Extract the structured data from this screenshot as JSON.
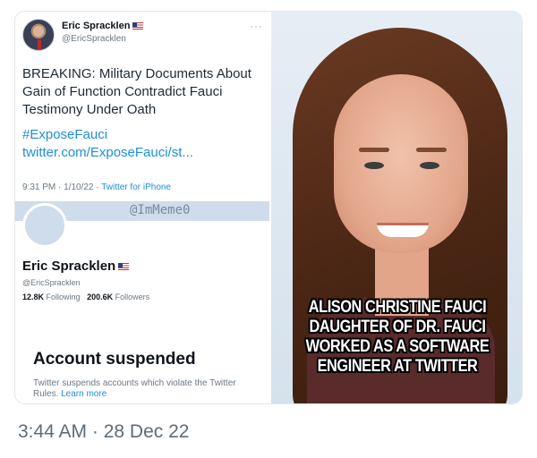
{
  "tweet": {
    "name": "Eric Spracklen",
    "handle": "@EricSpracklen",
    "text": "BREAKING: Military Documents About Gain of Function Contradict Fauci Testimony Under Oath",
    "link": "#ExposeFauci twitter.com/ExposeFauci/st...",
    "time": "9:31 PM · 1/10/22 · ",
    "source": "Twitter for iPhone",
    "more_icon": "more-dots-icon"
  },
  "watermark": "@ImMeme0",
  "profile": {
    "name": "Eric Spracklen",
    "handle": "@EricSpracklen",
    "following_count": "12.8K",
    "following_label": "Following",
    "followers_count": "200.6K",
    "followers_label": "Followers",
    "suspended_title": "Account suspended",
    "suspended_note": "Twitter suspends accounts which violate the Twitter Rules. ",
    "learn_more": "Learn more"
  },
  "meme": {
    "caption_lines": [
      "ALISON CHRISTINE FAUCI",
      "DAUGHTER OF DR. FAUCI",
      "WORKED AS A SOFTWARE",
      "ENGINEER AT TWITTER"
    ]
  },
  "post_timestamp": "3:44 AM · 28 Dec 22",
  "colors": {
    "link": "#1d8fdc",
    "muted": "#6b7884",
    "banner": "#cfdceb"
  }
}
